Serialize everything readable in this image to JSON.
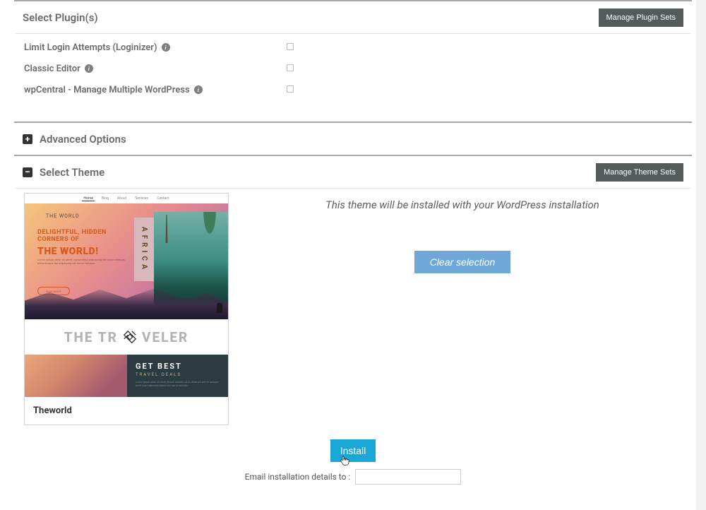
{
  "plugins_section": {
    "title": "Select Plugin(s)",
    "manage_btn": "Manage Plugin Sets",
    "items": [
      {
        "label": "Limit Login Attempts (Loginizer)"
      },
      {
        "label": "Classic Editor"
      },
      {
        "label": "wpCentral - Manage Multiple WordPress"
      }
    ]
  },
  "advanced": {
    "title": "Advanced Options"
  },
  "theme_section": {
    "title": "Select Theme",
    "manage_btn": "Manage Theme Sets",
    "message": "This theme will be installed with your WordPress installation",
    "clear_btn": "Clear selection",
    "theme_name": "Theworld",
    "preview": {
      "nav": [
        "Home",
        "Blog",
        "About",
        "Services",
        "Contact"
      ],
      "logo": "THE WORLD",
      "headline1": "DELIGHTFUL, HIDDEN\nCORNERS OF",
      "headline2": "THE WORLD!",
      "readmore": "READ MORE",
      "tag": "AFRICA",
      "mid": "THE TR  VELER",
      "bot_t1": "GET BEST",
      "bot_t2": "TRAVEL DEALS"
    }
  },
  "install_btn": "Install",
  "email": {
    "label": "Email installation details to :"
  }
}
